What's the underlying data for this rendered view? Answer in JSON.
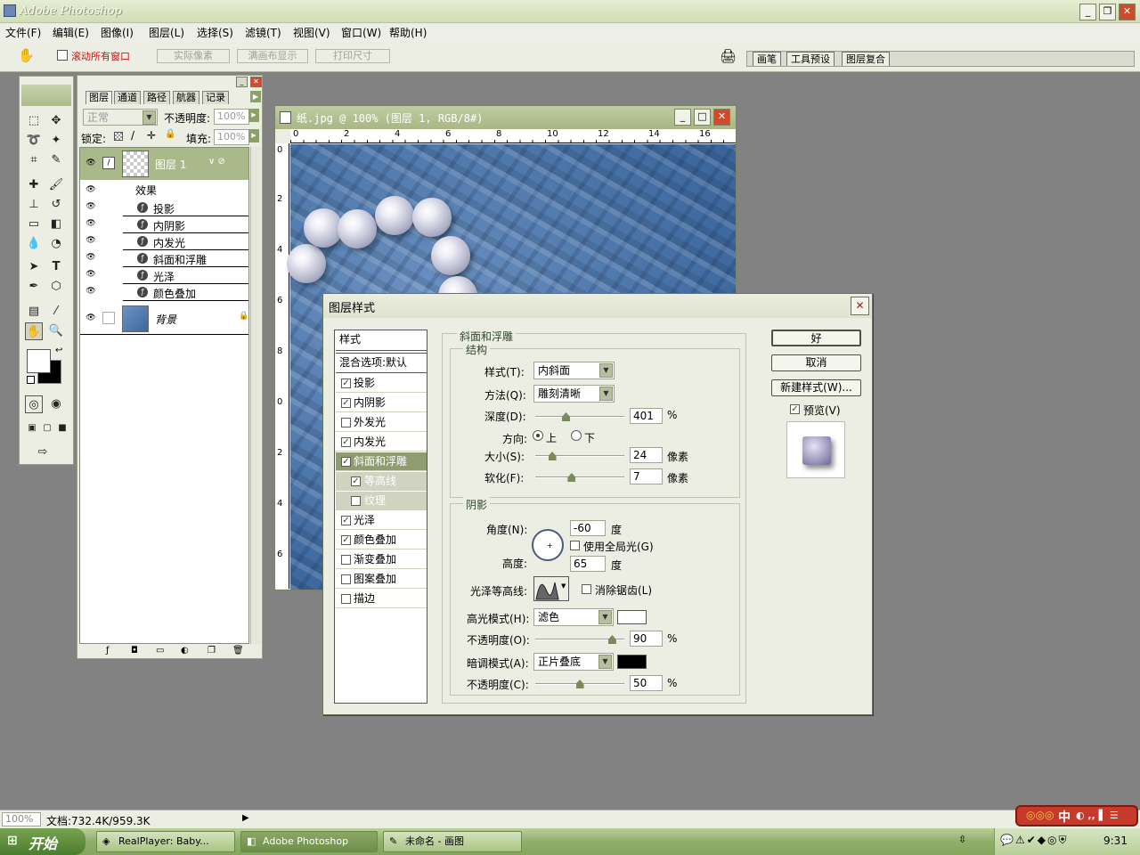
{
  "app": {
    "title": "Adobe Photoshop",
    "window_controls": {
      "minimize": "_",
      "restore": "❐",
      "close": "✕"
    }
  },
  "menu": [
    "文件(F)",
    "编辑(E)",
    "图像(I)",
    "图层(L)",
    "选择(S)",
    "滤镜(T)",
    "视图(V)",
    "窗口(W)",
    "帮助(H)"
  ],
  "options": {
    "scroll_all": "滚动所有窗口",
    "actual_pixels": "实际像素",
    "fit_screen": "满画布显示",
    "print_size": "打印尺寸"
  },
  "palette_well": [
    "画笔",
    "工具预设",
    "图层复合"
  ],
  "layers_panel": {
    "tabs": [
      "图层",
      "通道",
      "路径",
      "航器",
      "记录"
    ],
    "blend_mode": "正常",
    "opacity_label": "不透明度:",
    "opacity": "100%",
    "lock_label": "锁定:",
    "fill_label": "填充:",
    "fill": "100%",
    "layer1_name": "图层 1",
    "effects_label": "效果",
    "effects": [
      "投影",
      "内阴影",
      "内发光",
      "斜面和浮雕",
      "光泽",
      "颜色叠加"
    ],
    "background_name": "背景"
  },
  "document": {
    "title": "纸.jpg @ 100% (图层 1, RGB/8#)",
    "ruler_top": [
      "0",
      "2",
      "4",
      "6",
      "8",
      "10",
      "12",
      "14",
      "16"
    ],
    "ruler_left": [
      "0",
      "2",
      "4",
      "6",
      "8",
      "0",
      "2",
      "4",
      "6"
    ]
  },
  "dialog": {
    "title": "图层样式",
    "styles_header": "样式",
    "blend_options": "混合选项:默认",
    "style_items": [
      {
        "label": "投影",
        "checked": true
      },
      {
        "label": "内阴影",
        "checked": true
      },
      {
        "label": "外发光",
        "checked": false
      },
      {
        "label": "内发光",
        "checked": true
      },
      {
        "label": "斜面和浮雕",
        "checked": true,
        "selected": true
      },
      {
        "label": "等高线",
        "checked": true,
        "sub": true
      },
      {
        "label": "纹理",
        "checked": false,
        "sub": true
      },
      {
        "label": "光泽",
        "checked": true
      },
      {
        "label": "颜色叠加",
        "checked": true
      },
      {
        "label": "渐变叠加",
        "checked": false
      },
      {
        "label": "图案叠加",
        "checked": false
      },
      {
        "label": "描边",
        "checked": false
      }
    ],
    "bevel_title": "斜面和浮雕",
    "structure_title": "结构",
    "style_label": "样式(T):",
    "style_value": "内斜面",
    "technique_label": "方法(Q):",
    "technique_value": "雕刻清晰",
    "depth_label": "深度(D):",
    "depth_value": "401",
    "depth_unit": "%",
    "depth_slider": 0.33,
    "direction_label": "方向:",
    "dir_up": "上",
    "dir_down": "下",
    "size_label": "大小(S):",
    "size_value": "24",
    "size_unit": "像素",
    "size_slider": 0.16,
    "soften_label": "软化(F):",
    "soften_value": "7",
    "soften_unit": "像素",
    "soften_slider": 0.4,
    "shading_title": "阴影",
    "angle_label": "角度(N):",
    "angle_value": "-60",
    "angle_unit": "度",
    "global_light": "使用全局光(G)",
    "altitude_label": "高度:",
    "altitude_value": "65",
    "altitude_unit": "度",
    "gloss_label": "光泽等高线:",
    "anti_alias": "消除锯齿(L)",
    "highlight_label": "高光模式(H):",
    "highlight_mode": "滤色",
    "highlight_color": "#ffffff",
    "hl_opacity_label": "不透明度(O):",
    "hl_opacity": "90",
    "hl_opacity_unit": "%",
    "hl_slider": 0.9,
    "shadow_label": "暗调模式(A):",
    "shadow_mode": "正片叠底",
    "shadow_color": "#000000",
    "sh_opacity_label": "不透明度(C):",
    "sh_opacity": "50",
    "sh_opacity_unit": "%",
    "sh_slider": 0.5,
    "ok": "好",
    "cancel": "取消",
    "new_style": "新建样式(W)...",
    "preview": "预览(V)"
  },
  "status": {
    "zoom": "100%",
    "doc": "文档:732.4K/959.3K"
  },
  "taskbar": {
    "start": "开始",
    "tasks": [
      "RealPlayer: Baby...",
      "Adobe Photoshop",
      "未命名 - 画图"
    ],
    "clock": "9:31",
    "ime": "中"
  }
}
